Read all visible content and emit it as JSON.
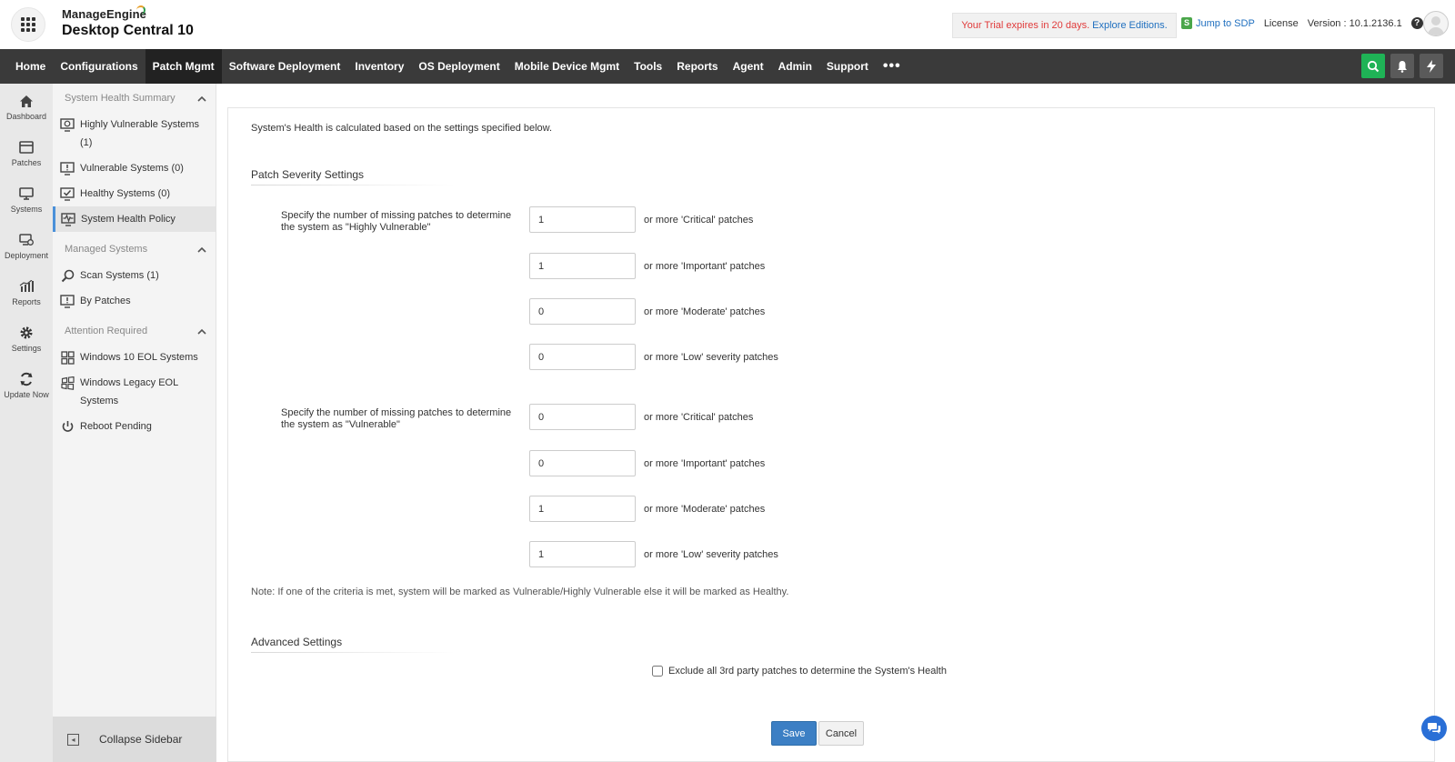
{
  "header": {
    "brand_company": "ManageEngine",
    "brand_product": "Desktop Central 10",
    "trial_prefix": "Your Trial expires in 20 days.",
    "trial_link": "Explore Editions.",
    "jump_sdp": "Jump to SDP",
    "license": "License",
    "version": "Version : 10.1.2136.1"
  },
  "nav": {
    "items": [
      "Home",
      "Configurations",
      "Patch Mgmt",
      "Software Deployment",
      "Inventory",
      "OS Deployment",
      "Mobile Device Mgmt",
      "Tools",
      "Reports",
      "Agent",
      "Admin",
      "Support"
    ],
    "active": "Patch Mgmt",
    "more": "•••"
  },
  "rail": {
    "items": [
      {
        "label": "Dashboard",
        "icon": "home-icon"
      },
      {
        "label": "Patches",
        "icon": "patches-icon"
      },
      {
        "label": "Systems",
        "icon": "monitor-icon"
      },
      {
        "label": "Deployment",
        "icon": "deployment-icon"
      },
      {
        "label": "Reports",
        "icon": "chart-icon"
      },
      {
        "label": "Settings",
        "icon": "gear-icon"
      },
      {
        "label": "Update Now",
        "icon": "refresh-icon"
      }
    ]
  },
  "sidebar": {
    "sections": [
      {
        "title": "System Health Summary"
      },
      {
        "title": "Managed Systems"
      },
      {
        "title": "Attention Required"
      }
    ],
    "health_items": [
      {
        "label": "Highly Vulnerable Systems (1)"
      },
      {
        "label": "Vulnerable Systems (0)"
      },
      {
        "label": "Healthy Systems (0)"
      },
      {
        "label": "System Health Policy"
      }
    ],
    "managed_items": [
      {
        "label": "Scan Systems (1)"
      },
      {
        "label": "By Patches"
      }
    ],
    "attention_items": [
      {
        "label": "Windows 10 EOL Systems"
      },
      {
        "label": "Windows Legacy EOL Systems"
      },
      {
        "label": "Reboot Pending"
      }
    ],
    "collapse": "Collapse Sidebar"
  },
  "main": {
    "intro": "System's Health is calculated based on the settings specified below.",
    "patch_severity_title": "Patch Severity Settings",
    "highly_vulnerable_label": "Specify the number of missing patches to determine the system as \"Highly Vulnerable\"",
    "highly_vulnerable": [
      {
        "value": "1",
        "suffix": "or more 'Critical' patches"
      },
      {
        "value": "1",
        "suffix": "or more 'Important' patches"
      },
      {
        "value": "0",
        "suffix": "or more 'Moderate' patches"
      },
      {
        "value": "0",
        "suffix": "or more 'Low' severity patches"
      }
    ],
    "vulnerable_label": "Specify the number of missing patches to determine the system as \"Vulnerable\"",
    "vulnerable": [
      {
        "value": "0",
        "suffix": "or more 'Critical' patches"
      },
      {
        "value": "0",
        "suffix": "or more 'Important' patches"
      },
      {
        "value": "1",
        "suffix": "or more 'Moderate' patches"
      },
      {
        "value": "1",
        "suffix": "or more 'Low' severity patches"
      }
    ],
    "note": "Note: If one of the criteria is met, system will be marked as Vulnerable/Highly Vulnerable else it will be marked as Healthy.",
    "advanced_title": "Advanced Settings",
    "exclude_label": "Exclude all 3rd party patches to determine the System's Health",
    "exclude_checked": false,
    "save": "Save",
    "cancel": "Cancel"
  },
  "colors": {
    "nav_bg": "#3a3a3a",
    "nav_active_bg": "#222222",
    "accent_blue": "#3c7fc4",
    "search_green": "#1fb356",
    "trial_red": "#e03a3a"
  }
}
